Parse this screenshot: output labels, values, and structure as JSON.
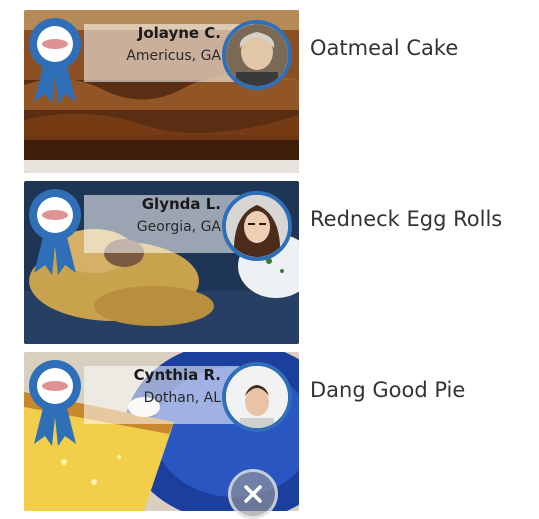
{
  "recipes": [
    {
      "cook_name": "Jolayne C.",
      "location": "Americus, GA",
      "title": "Oatmeal Cake",
      "ribbon_icon": "blue-ribbon-icon"
    },
    {
      "cook_name": "Glynda L.",
      "location": "Georgia, GA",
      "title": "Redneck Egg Rolls",
      "ribbon_icon": "blue-ribbon-icon"
    },
    {
      "cook_name": "Cynthia R.",
      "location": "Dothan, AL",
      "title": "Dang Good Pie",
      "ribbon_icon": "blue-ribbon-icon"
    }
  ],
  "close_button": {
    "icon": "close-icon"
  },
  "colors": {
    "ribbon_blue": "#2f6fb8",
    "avatar_ring": "#2f6fb8",
    "title_text": "#333333"
  }
}
